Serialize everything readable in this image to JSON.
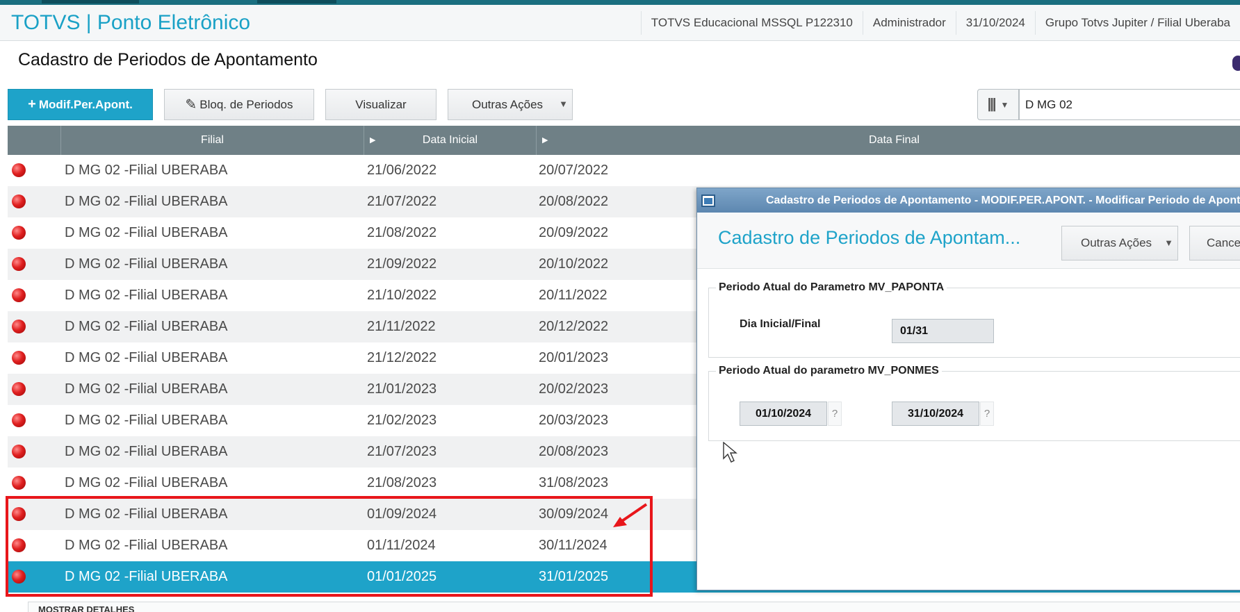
{
  "app": {
    "title": "TOTVS | Ponto Eletrônico",
    "info": [
      "TOTVS Educacional MSSQL P122310",
      "Administrador",
      "31/10/2024",
      "Grupo Totvs Jupiter / Filial Uberaba"
    ]
  },
  "page": {
    "title": "Cadastro de Periodos de Apontamento"
  },
  "toolbar": {
    "modif_label": "Modif.Per.Apont.",
    "bloq_label": "Bloq. de Periodos",
    "visualizar_label": "Visualizar",
    "outras_label": "Outras Ações",
    "search_value": "D MG 02"
  },
  "grid": {
    "headers": [
      "Filial",
      "Data Inicial",
      "Data Final"
    ],
    "rows": [
      {
        "filial": "D MG 02 -Filial UBERABA",
        "inicial": "21/06/2022",
        "final": "20/07/2022"
      },
      {
        "filial": "D MG 02 -Filial UBERABA",
        "inicial": "21/07/2022",
        "final": "20/08/2022"
      },
      {
        "filial": "D MG 02 -Filial UBERABA",
        "inicial": "21/08/2022",
        "final": "20/09/2022"
      },
      {
        "filial": "D MG 02 -Filial UBERABA",
        "inicial": "21/09/2022",
        "final": "20/10/2022"
      },
      {
        "filial": "D MG 02 -Filial UBERABA",
        "inicial": "21/10/2022",
        "final": "20/11/2022"
      },
      {
        "filial": "D MG 02 -Filial UBERABA",
        "inicial": "21/11/2022",
        "final": "20/12/2022"
      },
      {
        "filial": "D MG 02 -Filial UBERABA",
        "inicial": "21/12/2022",
        "final": "20/01/2023"
      },
      {
        "filial": "D MG 02 -Filial UBERABA",
        "inicial": "21/01/2023",
        "final": "20/02/2023"
      },
      {
        "filial": "D MG 02 -Filial UBERABA",
        "inicial": "21/02/2023",
        "final": "20/03/2023"
      },
      {
        "filial": "D MG 02 -Filial UBERABA",
        "inicial": "21/07/2023",
        "final": "20/08/2023"
      },
      {
        "filial": "D MG 02 -Filial UBERABA",
        "inicial": "21/08/2023",
        "final": "31/08/2023"
      },
      {
        "filial": "D MG 02 -Filial UBERABA",
        "inicial": "01/09/2024",
        "final": "30/09/2024"
      },
      {
        "filial": "D MG 02 -Filial UBERABA",
        "inicial": "01/11/2024",
        "final": "30/11/2024"
      },
      {
        "filial": "D MG 02 -Filial UBERABA",
        "inicial": "01/01/2025",
        "final": "31/01/2025"
      }
    ],
    "selected_index": 13
  },
  "bottom": {
    "label": "MOSTRAR DETALHES"
  },
  "dialog": {
    "window_title": "Cadastro de Periodos de Apontamento - MODIF.PER.APONT. - Modificar Periodo de Apontamento",
    "header_title": "Cadastro de Periodos de Apontam...",
    "outras_label": "Outras Ações",
    "cancel_label": "Cancelar",
    "group1": {
      "legend": "Periodo Atual do Parametro MV_PAPONTA",
      "label": "Dia Inicial/Final",
      "value": "01/31"
    },
    "group2": {
      "legend": "Periodo Atual do parametro MV_PONMES",
      "start": "01/10/2024",
      "end": "31/10/2024",
      "help": "?"
    }
  },
  "colors": {
    "accent": "#1ea3c9",
    "header_bg": "#6f8086",
    "highlight": "#e8161b"
  },
  "icons": [
    "plus-icon",
    "pencil-icon",
    "columns-icon",
    "chevron-down-icon",
    "status-red-dot-icon",
    "window-icon",
    "arrow-annotation-icon",
    "mouse-cursor-icon"
  ]
}
